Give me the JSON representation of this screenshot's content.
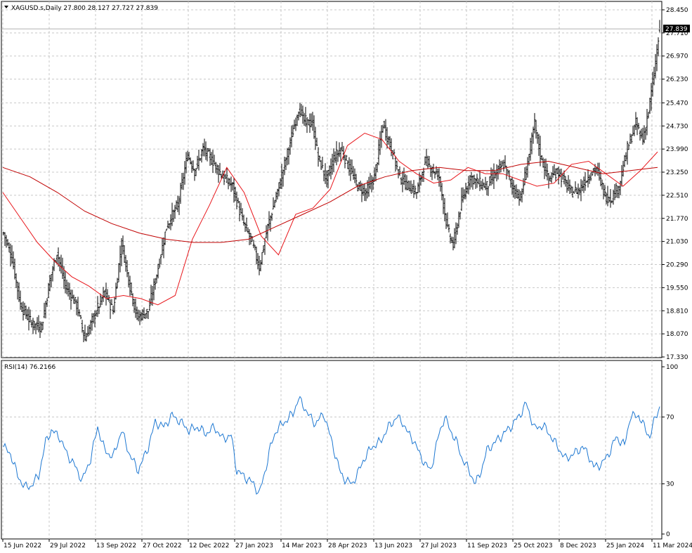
{
  "header": {
    "symbol_line": "XAGUSD.s,Daily  27.800 28.127 27.727 27.839",
    "current_price": "27.839"
  },
  "rsi": {
    "label": "RSI(14) 76.2166",
    "levels": [
      "100",
      "70",
      "30",
      "0"
    ],
    "range": [
      0,
      100
    ],
    "current_value": 76.2166
  },
  "colors": {
    "background": "#ffffff",
    "bars": "#000000",
    "ma_fast": "#e8161b",
    "ma_slow": "#c00000",
    "rsi_line": "#1e78d2",
    "grid": "#c8c8c8",
    "price_tag": "#000000"
  },
  "chart_data": {
    "type": "ohlc",
    "symbol": "XAGUSD.s",
    "timeframe": "Daily",
    "last_ohlc": {
      "open": 27.8,
      "high": 28.127,
      "low": 27.727,
      "close": 27.839
    },
    "ylim": [
      17.33,
      28.45
    ],
    "y_ticks": [
      "28.450",
      "27.710",
      "26.970",
      "26.230",
      "25.470",
      "24.730",
      "23.990",
      "23.250",
      "22.510",
      "21.770",
      "21.030",
      "20.290",
      "19.550",
      "18.810",
      "18.070",
      "17.330"
    ],
    "x_ticks": [
      "15 Jun 2022",
      "29 Jul 2022",
      "13 Sep 2022",
      "27 Oct 2022",
      "12 Dec 2022",
      "27 Jan 2023",
      "14 Mar 2023",
      "28 Apr 2023",
      "13 Jun 2023",
      "27 Jul 2023",
      "11 Sep 2023",
      "25 Oct 2023",
      "8 Dec 2023",
      "25 Jan 2024",
      "11 Mar 2024"
    ],
    "grid": true,
    "close_anchors": [
      [
        0,
        21.3
      ],
      [
        6,
        20.5
      ],
      [
        12,
        19.0
      ],
      [
        20,
        18.4
      ],
      [
        27,
        18.3
      ],
      [
        33,
        19.8
      ],
      [
        38,
        20.7
      ],
      [
        44,
        19.6
      ],
      [
        52,
        19.0
      ],
      [
        58,
        17.9
      ],
      [
        64,
        18.6
      ],
      [
        72,
        19.4
      ],
      [
        78,
        18.8
      ],
      [
        84,
        21.0
      ],
      [
        90,
        19.6
      ],
      [
        95,
        18.6
      ],
      [
        103,
        18.8
      ],
      [
        110,
        20.2
      ],
      [
        116,
        21.5
      ],
      [
        124,
        22.2
      ],
      [
        131,
        23.8
      ],
      [
        136,
        23.3
      ],
      [
        142,
        24.0
      ],
      [
        149,
        23.6
      ],
      [
        156,
        23.1
      ],
      [
        163,
        22.8
      ],
      [
        170,
        21.7
      ],
      [
        177,
        21.0
      ],
      [
        182,
        20.2
      ],
      [
        188,
        21.5
      ],
      [
        196,
        22.8
      ],
      [
        204,
        24.2
      ],
      [
        210,
        25.3
      ],
      [
        214,
        24.9
      ],
      [
        220,
        24.8
      ],
      [
        224,
        23.7
      ],
      [
        230,
        23.0
      ],
      [
        235,
        23.7
      ],
      [
        240,
        24.0
      ],
      [
        246,
        23.4
      ],
      [
        252,
        22.8
      ],
      [
        258,
        22.6
      ],
      [
        264,
        23.1
      ],
      [
        270,
        24.8
      ],
      [
        276,
        24.0
      ],
      [
        282,
        23.1
      ],
      [
        288,
        22.8
      ],
      [
        294,
        22.6
      ],
      [
        300,
        23.6
      ],
      [
        304,
        23.4
      ],
      [
        310,
        23.1
      ],
      [
        316,
        21.4
      ],
      [
        320,
        20.9
      ],
      [
        326,
        22.3
      ],
      [
        332,
        23.1
      ],
      [
        338,
        22.9
      ],
      [
        344,
        22.8
      ],
      [
        350,
        23.2
      ],
      [
        356,
        23.5
      ],
      [
        362,
        22.8
      ],
      [
        368,
        22.4
      ],
      [
        374,
        23.8
      ],
      [
        378,
        24.8
      ],
      [
        382,
        23.8
      ],
      [
        388,
        23.0
      ],
      [
        394,
        23.3
      ],
      [
        400,
        22.9
      ],
      [
        404,
        22.6
      ],
      [
        410,
        22.7
      ],
      [
        416,
        23.1
      ],
      [
        422,
        23.4
      ],
      [
        428,
        22.5
      ],
      [
        432,
        22.4
      ],
      [
        438,
        22.8
      ],
      [
        444,
        24.0
      ],
      [
        450,
        24.8
      ],
      [
        455,
        24.3
      ],
      [
        459,
        25.2
      ],
      [
        463,
        26.4
      ],
      [
        467,
        27.839
      ]
    ],
    "series": [
      {
        "name": "MA fast",
        "color": "#e8161b",
        "values": [
          22.6,
          21.8,
          21.0,
          20.4,
          19.9,
          19.6,
          19.2,
          19.3,
          19.2,
          19.0,
          19.3,
          21.1,
          22.2,
          23.4,
          22.6,
          21.2,
          20.6,
          21.9,
          22.1,
          22.7,
          24.1,
          24.5,
          24.3,
          23.6,
          23.2,
          22.9,
          23.0,
          23.4,
          23.2,
          23.2,
          23.0,
          22.8,
          22.9,
          23.5,
          23.6,
          23.2,
          22.8,
          23.3,
          23.9
        ]
      },
      {
        "name": "MA slow",
        "color": "#c00000",
        "values": [
          23.4,
          23.1,
          22.6,
          22.0,
          21.6,
          21.3,
          21.1,
          21.0,
          21.0,
          21.1,
          21.5,
          21.9,
          22.3,
          22.8,
          23.1,
          23.3,
          23.4,
          23.3,
          23.3,
          23.5,
          23.6,
          23.4,
          23.2,
          23.3,
          23.4
        ]
      }
    ],
    "rsi_anchors": [
      [
        0,
        52
      ],
      [
        5,
        48
      ],
      [
        10,
        35
      ],
      [
        15,
        28
      ],
      [
        20,
        29
      ],
      [
        25,
        35
      ],
      [
        30,
        55
      ],
      [
        34,
        62
      ],
      [
        40,
        58
      ],
      [
        45,
        48
      ],
      [
        50,
        42
      ],
      [
        56,
        32
      ],
      [
        62,
        45
      ],
      [
        67,
        64
      ],
      [
        72,
        50
      ],
      [
        78,
        46
      ],
      [
        84,
        62
      ],
      [
        90,
        47
      ],
      [
        96,
        38
      ],
      [
        103,
        52
      ],
      [
        108,
        67
      ],
      [
        114,
        64
      ],
      [
        120,
        71
      ],
      [
        126,
        67
      ],
      [
        132,
        62
      ],
      [
        138,
        64
      ],
      [
        144,
        60
      ],
      [
        150,
        64
      ],
      [
        156,
        57
      ],
      [
        162,
        59
      ],
      [
        166,
        38
      ],
      [
        172,
        34
      ],
      [
        178,
        30
      ],
      [
        182,
        24
      ],
      [
        186,
        37
      ],
      [
        190,
        52
      ],
      [
        194,
        62
      ],
      [
        200,
        67
      ],
      [
        206,
        72
      ],
      [
        210,
        81
      ],
      [
        214,
        76
      ],
      [
        218,
        70
      ],
      [
        222,
        66
      ],
      [
        228,
        72
      ],
      [
        232,
        60
      ],
      [
        236,
        48
      ],
      [
        240,
        36
      ],
      [
        244,
        32
      ],
      [
        248,
        30
      ],
      [
        252,
        36
      ],
      [
        256,
        44
      ],
      [
        262,
        52
      ],
      [
        268,
        55
      ],
      [
        274,
        64
      ],
      [
        280,
        70
      ],
      [
        284,
        67
      ],
      [
        288,
        60
      ],
      [
        292,
        56
      ],
      [
        296,
        48
      ],
      [
        300,
        42
      ],
      [
        304,
        38
      ],
      [
        310,
        60
      ],
      [
        314,
        70
      ],
      [
        318,
        62
      ],
      [
        322,
        56
      ],
      [
        326,
        46
      ],
      [
        330,
        40
      ],
      [
        336,
        30
      ],
      [
        340,
        38
      ],
      [
        344,
        50
      ],
      [
        350,
        55
      ],
      [
        356,
        60
      ],
      [
        362,
        65
      ],
      [
        368,
        72
      ],
      [
        372,
        78
      ],
      [
        378,
        63
      ],
      [
        384,
        65
      ],
      [
        390,
        58
      ],
      [
        396,
        50
      ],
      [
        400,
        45
      ],
      [
        406,
        48
      ],
      [
        412,
        52
      ],
      [
        416,
        48
      ],
      [
        420,
        40
      ],
      [
        426,
        42
      ],
      [
        432,
        50
      ],
      [
        436,
        58
      ],
      [
        442,
        53
      ],
      [
        446,
        70
      ],
      [
        452,
        71
      ],
      [
        456,
        64
      ],
      [
        460,
        58
      ],
      [
        464,
        70
      ],
      [
        467,
        76.2
      ]
    ]
  }
}
